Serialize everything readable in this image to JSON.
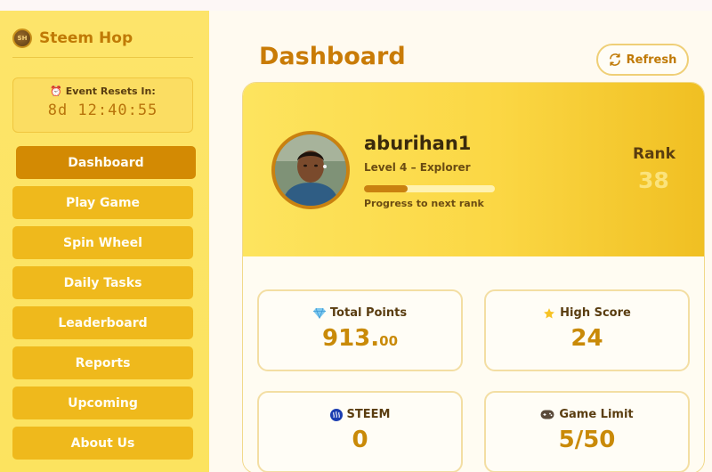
{
  "brand": {
    "name": "Steem Hop",
    "logo_text": "STEEM HOP"
  },
  "event": {
    "title": "Event Resets In:",
    "icon": "alarm-clock-icon",
    "timer": "8d 12:40:55"
  },
  "nav": {
    "items": [
      {
        "label": "Dashboard",
        "active": true
      },
      {
        "label": "Play Game"
      },
      {
        "label": "Spin Wheel"
      },
      {
        "label": "Daily Tasks"
      },
      {
        "label": "Leaderboard"
      },
      {
        "label": "Reports"
      },
      {
        "label": "Upcoming"
      },
      {
        "label": "About Us"
      }
    ]
  },
  "header": {
    "title": "Dashboard",
    "refresh_label": "Refresh"
  },
  "profile": {
    "username": "aburihan1",
    "level": "Level 4 – Explorer",
    "progress_fraction": 0.33,
    "progress_label": "Progress to next rank",
    "rank_label": "Rank",
    "rank_value": "38"
  },
  "stats": {
    "total_points": {
      "label": "Total Points",
      "icon": "diamond-icon",
      "value_int": "913.",
      "value_dec": "00"
    },
    "high_score": {
      "label": "High Score",
      "icon": "star-icon",
      "value": "24"
    },
    "steem": {
      "label": "STEEM",
      "icon": "steem-logo-icon",
      "value": "0"
    },
    "game_limit": {
      "label": "Game Limit",
      "icon": "gamepad-icon",
      "value": "5/50"
    }
  },
  "colors": {
    "sidebar_bg": "#fde46a",
    "nav_button": "#efb91c",
    "nav_active": "#d38a03",
    "accent": "#c97b06",
    "stat_value": "#c98a08"
  }
}
